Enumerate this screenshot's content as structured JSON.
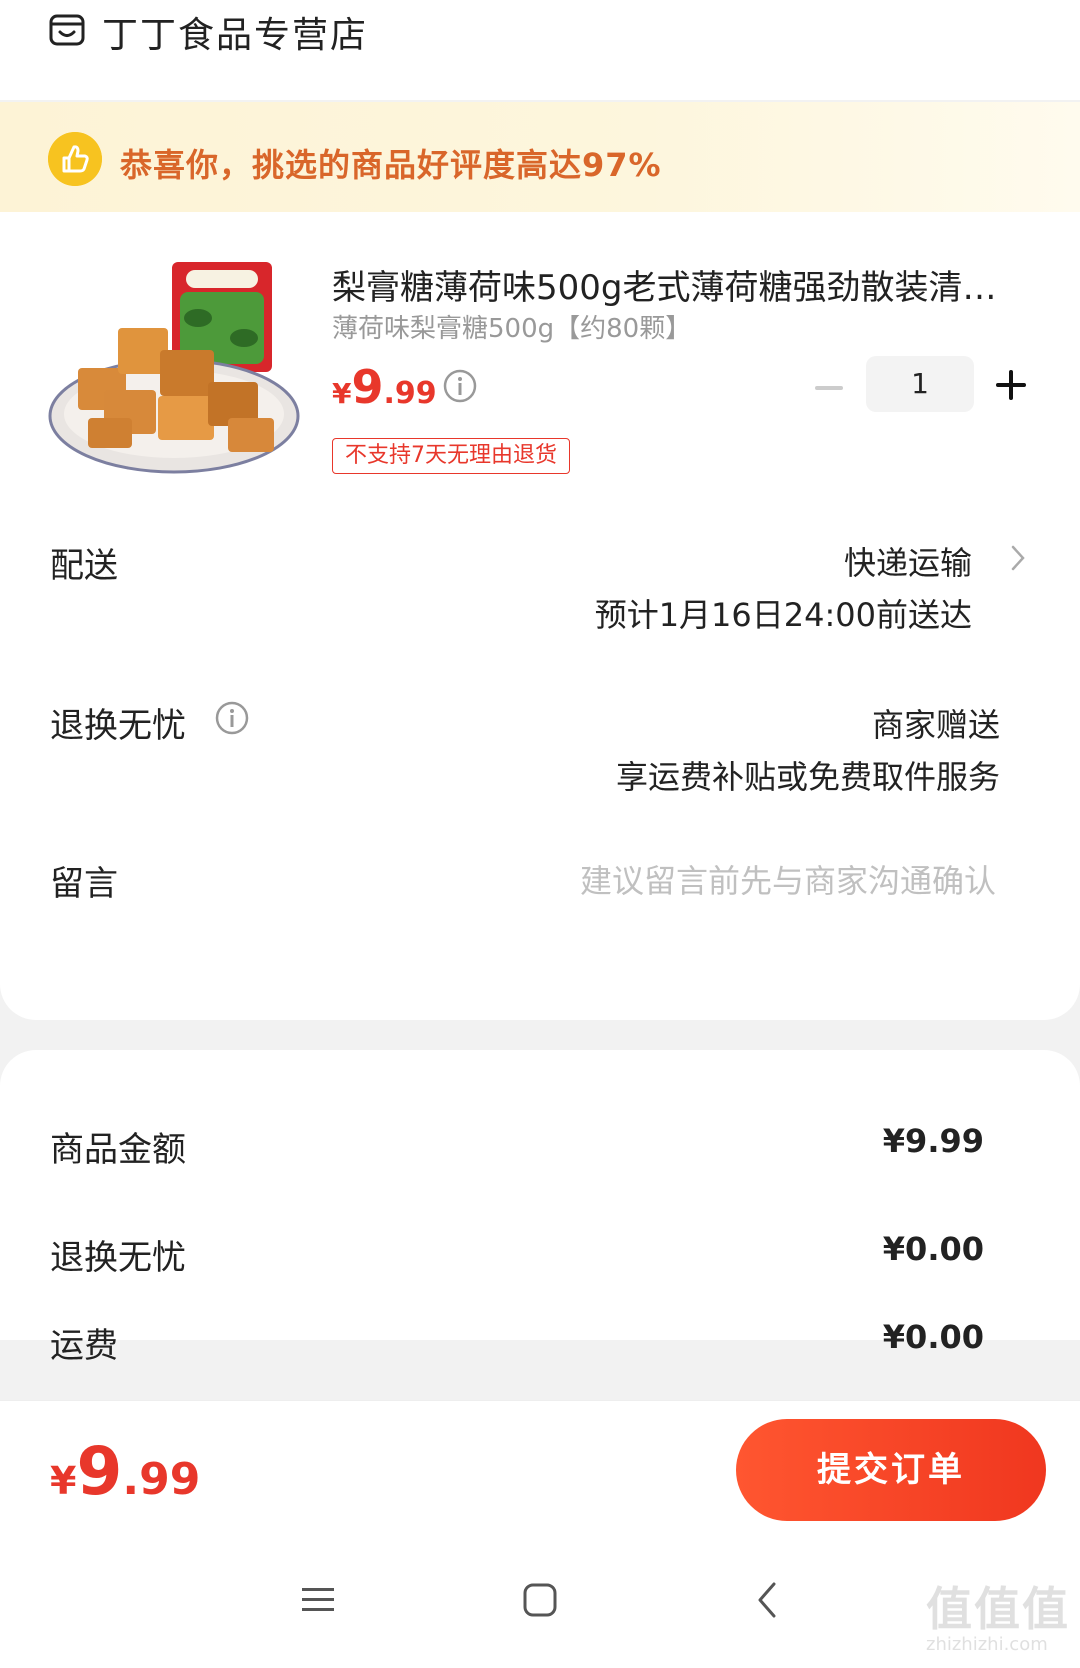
{
  "store": {
    "name": "丁丁食品专营店",
    "icon": "store-icon"
  },
  "praise": {
    "text": "恭喜你，挑选的商品好评度高达97%",
    "icon": "thumbs-up-icon"
  },
  "product": {
    "title": "梨膏糖薄荷味500g老式薄荷糖强劲散装清…",
    "spec": "薄荷味梨膏糖500g【约80颗】",
    "price": {
      "symbol": "¥",
      "integer": "9",
      "decimal": ".99"
    },
    "quantity": "1",
    "badge": "不支持7天无理由退货"
  },
  "delivery": {
    "label": "配送",
    "method": "快递运输",
    "eta": "预计1月16日24:00前送达"
  },
  "return_service": {
    "label": "退换无忧",
    "value": "商家赠送",
    "detail": "享运费补贴或免费取件服务"
  },
  "message": {
    "label": "留言",
    "placeholder": "建议留言前先与商家沟通确认"
  },
  "summary": {
    "rows": [
      {
        "label": "商品金额",
        "value": "¥9.99"
      },
      {
        "label": "退换无忧",
        "value": "¥0.00"
      },
      {
        "label": "运费",
        "value": "¥0.00"
      }
    ]
  },
  "footer": {
    "total": {
      "symbol": "¥",
      "integer": "9",
      "decimal": ".99"
    },
    "submit_label": "提交订单"
  },
  "nav": {
    "menu_icon": "menu-icon",
    "home_icon": "home-icon",
    "back_icon": "back-icon"
  },
  "watermark": {
    "text": "值值值",
    "subtext": "zhizhizhi.com"
  },
  "colors": {
    "accent": "#e8372b",
    "praise_text": "#d9662a",
    "praise_icon": "#f7c320"
  }
}
